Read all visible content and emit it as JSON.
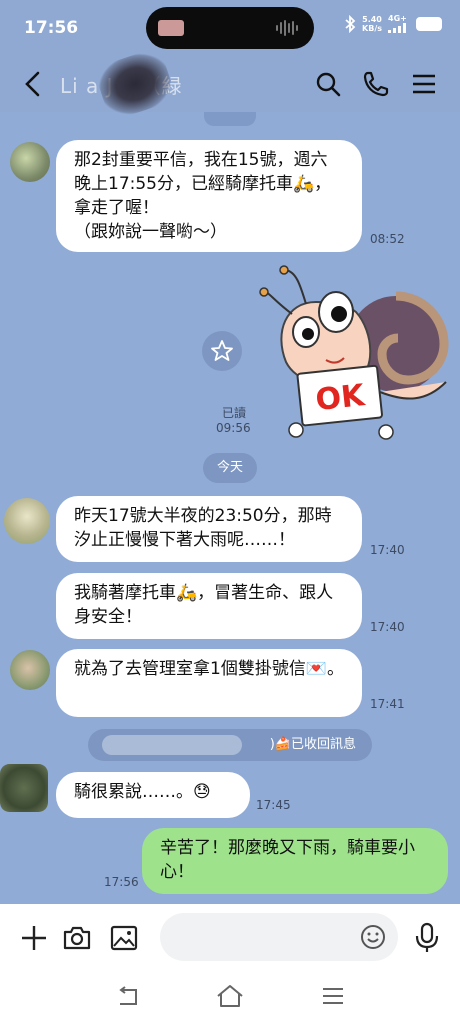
{
  "status_bar": {
    "time": "17:56",
    "speed_value": "5.40",
    "speed_unit": "KB/s",
    "network": "4G+"
  },
  "header": {
    "contact_name": "Li  a  Jen（緑",
    "back_icon": "chevron-left-icon",
    "search_icon": "search-icon",
    "call_icon": "phone-icon",
    "menu_icon": "menu-icon"
  },
  "messages": [
    {
      "side": "received",
      "text": "那2封重要平信，我在15號，週六晚上17:55分，已經騎摩托車🛵，拿走了喔！\n（跟妳說一聲喲～）",
      "time": "08:52"
    },
    {
      "side": "sent-sticker",
      "sticker_text": "OK",
      "read": "已讀",
      "time": "09:56"
    },
    {
      "side": "received",
      "text": "昨天17號大半夜的23:50分，那時汐止正慢慢下著大雨呢……！",
      "time": "17:40"
    },
    {
      "side": "received",
      "text": "我騎著摩托車🛵，冒著生命、跟人身安全！",
      "time": "17:40"
    },
    {
      "side": "received",
      "text": "就為了去管理室拿1個雙掛號信💌。",
      "time": "17:41"
    },
    {
      "side": "received",
      "text": "騎很累說……。😓",
      "time": "17:45"
    },
    {
      "side": "sent",
      "text": "辛苦了！那麼晚又下雨，騎車要小心！",
      "time": "17:56"
    }
  ],
  "date_divider": "今天",
  "system_notice": ")🍰已收回訊息",
  "input": {
    "placeholder": ""
  },
  "colors": {
    "chat_bg": "#8fabd6",
    "sent_bubble": "#9ee38c",
    "received_bubble": "#ffffff"
  }
}
